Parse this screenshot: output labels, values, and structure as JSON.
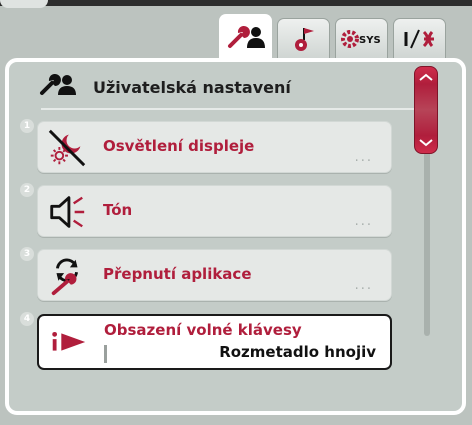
{
  "tabs": [
    {
      "icon": "wrench-user-icon",
      "active": true
    },
    {
      "icon": "service-pin-icon",
      "active": false
    },
    {
      "icon": "gear-sys-icon",
      "label": "SYS",
      "active": false
    },
    {
      "icon": "io-symbol-icon",
      "active": false
    }
  ],
  "header": {
    "icon": "wrench-user-icon",
    "title": "Uživatelská nastavení"
  },
  "items": [
    {
      "number": "1",
      "icon": "display-brightness-icon",
      "label": "Osvětlení displeje",
      "more": "..."
    },
    {
      "number": "2",
      "icon": "speaker-icon",
      "label": "Tón",
      "more": "..."
    },
    {
      "number": "3",
      "icon": "app-switch-icon",
      "label": "Přepnutí aplikace",
      "more": "..."
    },
    {
      "number": "4",
      "icon": "info-arrow-icon",
      "label": "Obsazení volné klávesy",
      "value": "Rozmetadlo hnojiv",
      "selected": true
    }
  ],
  "colors": {
    "accent": "#b01e3c",
    "background": "#c4ccc8",
    "card": "#e5e8e6"
  }
}
